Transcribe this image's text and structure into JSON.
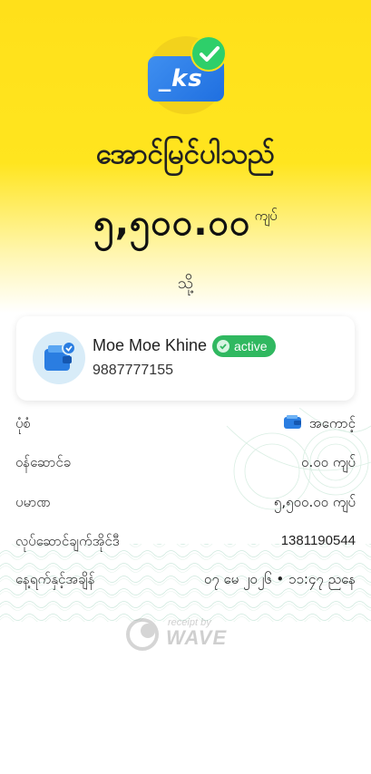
{
  "logo": {
    "card_text": "_ks",
    "icon": "wallet-check-icon"
  },
  "status_title": "အောင်မြင်ပါသည်",
  "amount": {
    "value": "၅,၅၀၀.၀၀",
    "unit": "ကျပ်"
  },
  "to_label": "သို့",
  "recipient": {
    "name": "Moe Moe Khine",
    "status": "active",
    "phone": "9887777155",
    "avatar_icon": "wallet-icon"
  },
  "details": [
    {
      "label": "ပုံစံ",
      "value": "အကောင့်",
      "icon": "wallet-small-icon"
    },
    {
      "label": "ဝန်ဆောင်ခ",
      "value": "၀.၀၀ ကျပ်"
    },
    {
      "label": "ပမာဏ",
      "value": "၅,၅၀၀.၀၀ ကျပ်"
    },
    {
      "label": "လုပ်ဆောင်ချက်အိုင်ဒီ",
      "value": "1381190544"
    },
    {
      "label": "နေ့ရက်နှင့်အချိန်",
      "value": "၀၇ မေ ၂၀၂၆ • ၁၁:၄၇ ညနေ"
    }
  ],
  "footer": {
    "receipt_by": "receipt by",
    "brand": "WAVE"
  },
  "colors": {
    "yellow": "#ffe01a",
    "green": "#30b860",
    "blue": "#1f6fe0"
  }
}
